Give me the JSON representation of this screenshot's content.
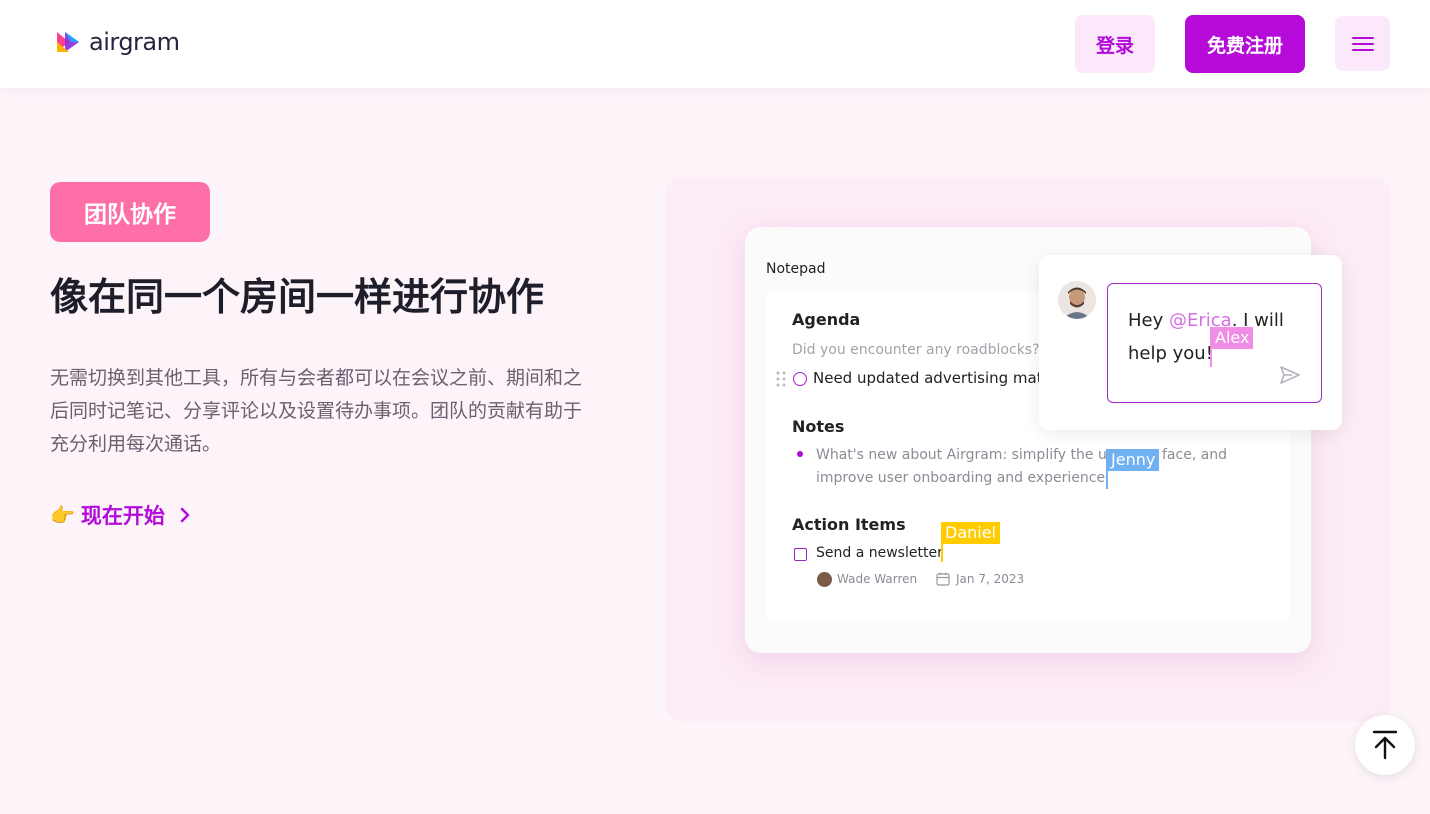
{
  "header": {
    "logo_text": "airgram",
    "login_label": "登录",
    "signup_label": "免费注册"
  },
  "hero": {
    "tag": "团队协作",
    "title": "像在同一个房间一样进行协作",
    "description": "无需切换到其他工具，所有与会者都可以在会议之前、期间和之后同时记笔记、分享评论以及设置待办事项。团队的贡献有助于充分利用每次通话。",
    "cta_emoji": "👉",
    "cta_label": "现在开始"
  },
  "notepad": {
    "title": "Notepad",
    "agenda_heading": "Agenda",
    "agenda_question": "Did you encounter any roadblocks?",
    "agenda_item": "Need updated advertising mater",
    "notes_heading": "Notes",
    "notes_line1": "What's new about Airgram: simplify the us",
    "notes_line1_end": "face, and",
    "notes_line2": "improve user onboarding and experience.",
    "action_heading": "Action Items",
    "action_item": "Send a newsletter",
    "assignee": "Wade Warren",
    "due_date": "Jan 7, 2023"
  },
  "chat": {
    "text_before": "Hey ",
    "mention": "@Erica",
    "text_after": ". I will help you!"
  },
  "cursors": {
    "alex": "Alex",
    "jenny": "Jenny",
    "daniel": "Daniel"
  },
  "colors": {
    "brand_purple": "#b60ad9",
    "tag_pink": "#ff6fa7",
    "cursor_alex": "#f08ee6",
    "cursor_jenny": "#6fb1f2",
    "cursor_daniel": "#ffcc00"
  },
  "icons": {
    "menu": "hamburger-icon",
    "cta_arrow": "chevron-right-icon",
    "send": "send-icon",
    "scroll_top": "arrow-up-to-top-icon",
    "calendar": "calendar-icon",
    "drag": "drag-handle-icon"
  }
}
